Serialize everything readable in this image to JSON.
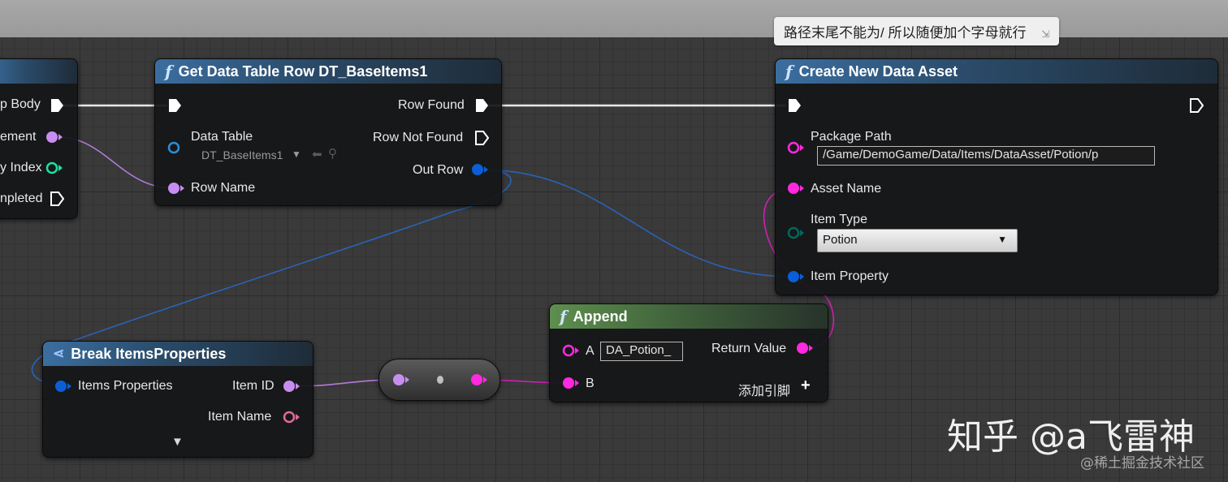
{
  "tooltip": "路径末尾不能为/ 所以随便加个字母就行",
  "left_node": {
    "pins": [
      "p Body",
      "ement",
      "y Index",
      "npleted"
    ]
  },
  "get_row": {
    "title": "Get Data Table Row DT_BaseItems1",
    "data_table_label": "Data Table",
    "data_table_value": "DT_BaseItems1",
    "row_name_label": "Row Name",
    "row_found": "Row Found",
    "row_not_found": "Row Not Found",
    "out_row": "Out Row"
  },
  "create_asset": {
    "title": "Create New Data Asset",
    "package_path_label": "Package Path",
    "package_path_value": "/Game/DemoGame/Data/Items/DataAsset/Potion/p",
    "asset_name_label": "Asset Name",
    "item_type_label": "Item Type",
    "item_type_value": "Potion",
    "item_property_label": "Item Property"
  },
  "append": {
    "title": "Append",
    "a_label": "A",
    "a_value": "DA_Potion_",
    "b_label": "B",
    "return_value": "Return Value",
    "add_pin": "添加引脚"
  },
  "break_props": {
    "title": "Break ItemsProperties",
    "items_properties": "Items Properties",
    "item_id": "Item ID",
    "item_name": "Item Name"
  },
  "watermark": {
    "main": "知乎 @a飞雷神",
    "sub": "@稀土掘金技术社区"
  },
  "colors": {
    "exec": "#ffffff",
    "string_pin": "#ff29e0",
    "name_pin": "#c78ef0",
    "struct_pin": "#0a5fd6",
    "int_pin": "#1fe0a0",
    "enum_pin": "#00695c",
    "wire_exec": "#ffffff",
    "wire_struct": "#2a62b8",
    "wire_name": "#b27ad8",
    "wire_string": "#d01fb3"
  }
}
